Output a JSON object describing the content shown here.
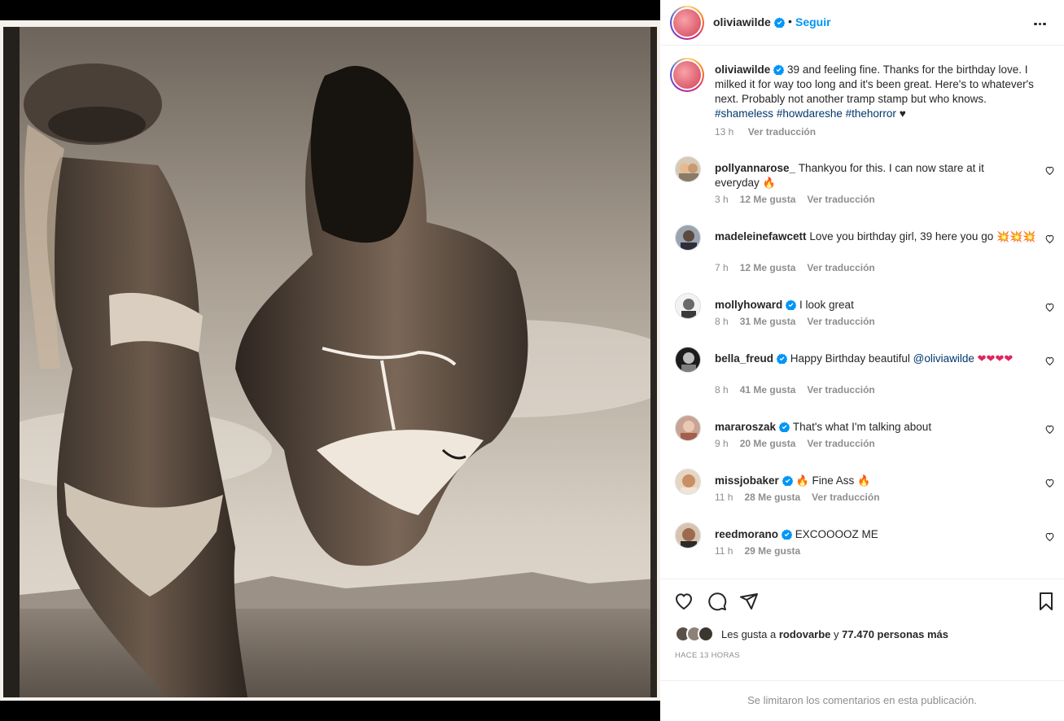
{
  "post": {
    "username": "oliviawilde",
    "follow_label": "Seguir",
    "separator": "•"
  },
  "caption": {
    "username": "oliviawilde",
    "text": "39 and feeling fine. Thanks for the birthday love. I milked it for way too long and it's been great. Here's to whatever's next. Probably not another tramp stamp but who knows.",
    "hashtags": [
      "#shameless",
      "#howdareshe",
      "#thehorror"
    ],
    "trailing": "♥",
    "time": "13 h",
    "translate": "Ver traducción"
  },
  "comments": [
    {
      "username": "pollyannarose_",
      "verified": false,
      "text": "Thankyou for this. I can now stare at it everyday",
      "emoji": "🔥",
      "time": "3 h",
      "likes": "12 Me gusta",
      "translate": "Ver traducción"
    },
    {
      "username": "madeleinefawcett",
      "verified": false,
      "text": "Love you birthday girl, 39 here you go",
      "emoji": "💥💥💥",
      "time": "7 h",
      "likes": "12 Me gusta",
      "translate": "Ver traducción"
    },
    {
      "username": "mollyhoward",
      "verified": true,
      "text": "I look great",
      "time": "8 h",
      "likes": "31 Me gusta",
      "translate": "Ver traducción"
    },
    {
      "username": "bella_freud",
      "verified": true,
      "text": "Happy Birthday beautiful",
      "mention": "@oliviawilde",
      "emoji": "❤❤❤❤",
      "time": "8 h",
      "likes": "41 Me gusta",
      "translate": "Ver traducción"
    },
    {
      "username": "mararoszak",
      "verified": true,
      "text": "That's what I'm talking about",
      "time": "9 h",
      "likes": "20 Me gusta",
      "translate": "Ver traducción"
    },
    {
      "username": "missjobaker",
      "verified": true,
      "text": "Fine Ass",
      "emoji": "🔥",
      "time": "11 h",
      "likes": "28 Me gusta",
      "translate": "Ver traducción"
    },
    {
      "username": "reedmorano",
      "verified": true,
      "text": "EXCOOOOZ ME",
      "time": "11 h",
      "likes": "29 Me gusta"
    }
  ],
  "likes_summary": {
    "prefix": "Les gusta a",
    "user": "rodovarbe",
    "joiner": "y",
    "others": "77.470 personas más"
  },
  "posted_ago": "HACE 13 HORAS",
  "comments_limited": "Se limitaron los comentarios en esta publicación.",
  "colors": {
    "accent": "#0095f6",
    "hashtag": "#00376b",
    "muted": "#8e8e8e",
    "text": "#262626",
    "border": "#efefef"
  },
  "icons": [
    "verified-icon",
    "more-options-icon",
    "heart-icon",
    "comment-icon",
    "share-icon",
    "bookmark-icon"
  ]
}
